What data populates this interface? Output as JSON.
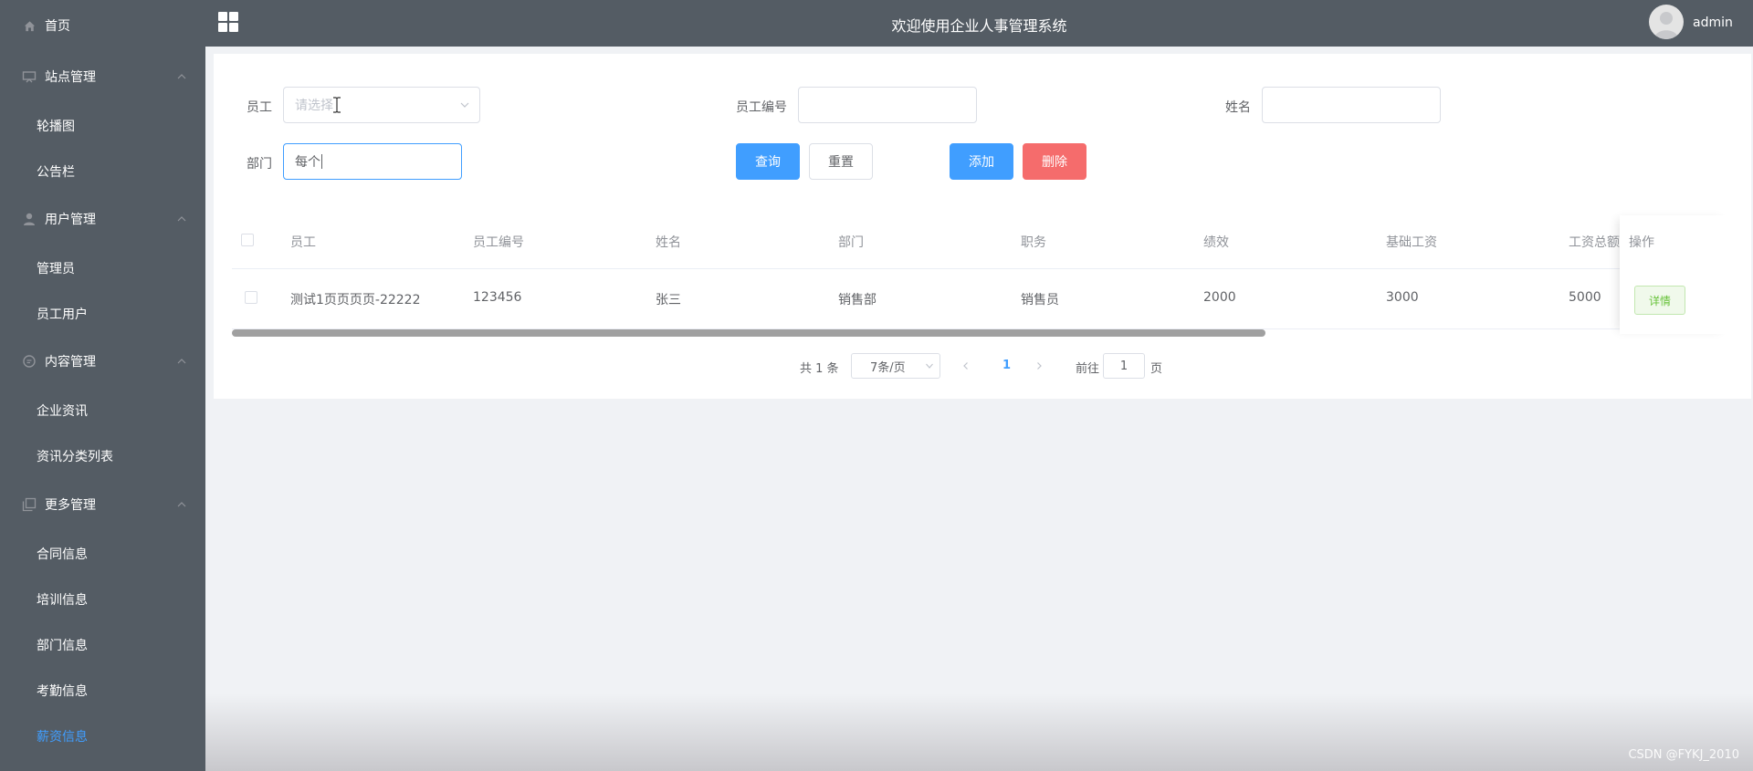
{
  "header": {
    "title": "欢迎使用企业人事管理系统",
    "user_name": "admin"
  },
  "sidebar": {
    "home": "首页",
    "groups": [
      {
        "label": "站点管理",
        "items": [
          "轮播图",
          "公告栏"
        ]
      },
      {
        "label": "用户管理",
        "items": [
          "管理员",
          "员工用户"
        ]
      },
      {
        "label": "内容管理",
        "items": [
          "企业资讯",
          "资讯分类列表"
        ]
      },
      {
        "label": "更多管理",
        "items": [
          "合同信息",
          "培训信息",
          "部门信息",
          "考勤信息",
          "薪资信息"
        ]
      }
    ],
    "active_item": "薪资信息"
  },
  "search": {
    "employee_label": "员工",
    "employee_placeholder": "请选择",
    "employee_no_label": "员工编号",
    "employee_no_value": "",
    "name_label": "姓名",
    "name_value": "",
    "department_label": "部门",
    "department_value": "每个",
    "query_button": "查询",
    "reset_button": "重置",
    "add_button": "添加",
    "delete_button": "删除"
  },
  "table": {
    "headers": [
      "员工",
      "员工编号",
      "姓名",
      "部门",
      "职务",
      "绩效",
      "基础工资",
      "工资总额",
      "操作"
    ],
    "rows": [
      {
        "employee": "测试1页页页页-22222",
        "employee_no": "123456",
        "name": "张三",
        "department": "销售部",
        "position": "销售员",
        "performance": "2000",
        "base_salary": "3000",
        "total_salary": "5000",
        "action": "详情"
      }
    ]
  },
  "pagination": {
    "total_text": "共 1 条",
    "page_size": "7条/页",
    "current_page": "1",
    "goto_label": "前往",
    "goto_value": "1",
    "page_suffix": "页"
  },
  "watermark": "CSDN @FYKJ_2010",
  "colors": {
    "sidebar_bg": "#545c64",
    "primary": "#409eff",
    "danger": "#f56c6c",
    "success": "#67c23a"
  }
}
